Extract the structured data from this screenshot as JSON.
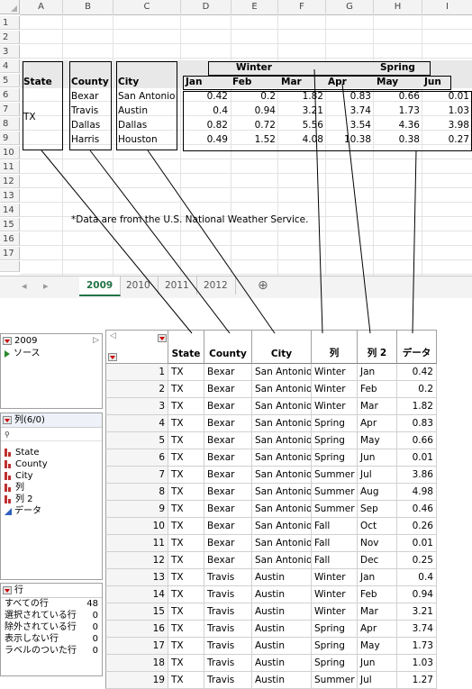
{
  "excel": {
    "columns": [
      "A",
      "B",
      "C",
      "D",
      "E",
      "F",
      "G",
      "H",
      "I"
    ],
    "rows": [
      "1",
      "2",
      "3",
      "4",
      "5",
      "6",
      "7",
      "8",
      "9",
      "10",
      "11",
      "12",
      "13",
      "14",
      "15",
      "16",
      "17"
    ],
    "header_row4": {
      "winter": "Winter",
      "spring": "Spring"
    },
    "header_row5": {
      "state": "State",
      "county": "County",
      "city": "City",
      "jan": "Jan",
      "feb": "Feb",
      "mar": "Mar",
      "apr": "Apr",
      "may": "May",
      "jun": "Jun"
    },
    "state_merged": "TX",
    "data_rows": [
      {
        "county": "Bexar",
        "city": "San Antonio",
        "vals": [
          "0.42",
          "0.2",
          "1.82",
          "0.83",
          "0.66",
          "0.01"
        ]
      },
      {
        "county": "Travis",
        "city": "Austin",
        "vals": [
          "0.4",
          "0.94",
          "3.21",
          "3.74",
          "1.73",
          "1.03"
        ]
      },
      {
        "county": "Dallas",
        "city": "Dallas",
        "vals": [
          "0.82",
          "0.72",
          "5.56",
          "3.54",
          "4.36",
          "3.98"
        ]
      },
      {
        "county": "Harris",
        "city": "Houston",
        "vals": [
          "0.49",
          "1.52",
          "4.08",
          "10.38",
          "0.38",
          "0.27"
        ]
      }
    ],
    "note": "*Data are from the U.S. National Weather Service.",
    "sheet_tabs": [
      "2009",
      "2010",
      "2011",
      "2012"
    ],
    "active_tab": "2009",
    "add_sheet_symbol": "⊕",
    "nav_left": "◂",
    "nav_right": "▸"
  },
  "jmp": {
    "table_panel": {
      "title": "2009",
      "source": "ソース"
    },
    "columns_panel": {
      "title": "列(6/0)",
      "search_symbol": "🔍",
      "items": [
        {
          "label": "State",
          "icon": "nominal-icon"
        },
        {
          "label": "County",
          "icon": "nominal-icon"
        },
        {
          "label": "City",
          "icon": "nominal-icon"
        },
        {
          "label": "列",
          "icon": "nominal-icon"
        },
        {
          "label": "列 2",
          "icon": "nominal-icon"
        },
        {
          "label": "データ",
          "icon": "continuous-icon"
        }
      ]
    },
    "rows_panel": {
      "title": "行",
      "items": [
        {
          "label": "すべての行",
          "value": "48"
        },
        {
          "label": "選択されている行",
          "value": "0"
        },
        {
          "label": "除外されている行",
          "value": "0"
        },
        {
          "label": "表示しない行",
          "value": "0"
        },
        {
          "label": "ラベルのついた行",
          "value": "0"
        }
      ]
    },
    "table_headers": [
      "State",
      "County",
      "City",
      "列",
      "列 2",
      "データ"
    ],
    "table_rows": [
      [
        "1",
        "TX",
        "Bexar",
        "San Antonio",
        "Winter",
        "Jan",
        "0.42"
      ],
      [
        "2",
        "TX",
        "Bexar",
        "San Antonio",
        "Winter",
        "Feb",
        "0.2"
      ],
      [
        "3",
        "TX",
        "Bexar",
        "San Antonio",
        "Winter",
        "Mar",
        "1.82"
      ],
      [
        "4",
        "TX",
        "Bexar",
        "San Antonio",
        "Spring",
        "Apr",
        "0.83"
      ],
      [
        "5",
        "TX",
        "Bexar",
        "San Antonio",
        "Spring",
        "May",
        "0.66"
      ],
      [
        "6",
        "TX",
        "Bexar",
        "San Antonio",
        "Spring",
        "Jun",
        "0.01"
      ],
      [
        "7",
        "TX",
        "Bexar",
        "San Antonio",
        "Summer",
        "Jul",
        "3.86"
      ],
      [
        "8",
        "TX",
        "Bexar",
        "San Antonio",
        "Summer",
        "Aug",
        "4.98"
      ],
      [
        "9",
        "TX",
        "Bexar",
        "San Antonio",
        "Summer",
        "Sep",
        "0.46"
      ],
      [
        "10",
        "TX",
        "Bexar",
        "San Antonio",
        "Fall",
        "Oct",
        "0.26"
      ],
      [
        "11",
        "TX",
        "Bexar",
        "San Antonio",
        "Fall",
        "Nov",
        "0.01"
      ],
      [
        "12",
        "TX",
        "Bexar",
        "San Antonio",
        "Fall",
        "Dec",
        "0.25"
      ],
      [
        "13",
        "TX",
        "Travis",
        "Austin",
        "Winter",
        "Jan",
        "0.4"
      ],
      [
        "14",
        "TX",
        "Travis",
        "Austin",
        "Winter",
        "Feb",
        "0.94"
      ],
      [
        "15",
        "TX",
        "Travis",
        "Austin",
        "Winter",
        "Mar",
        "3.21"
      ],
      [
        "16",
        "TX",
        "Travis",
        "Austin",
        "Spring",
        "Apr",
        "3.74"
      ],
      [
        "17",
        "TX",
        "Travis",
        "Austin",
        "Spring",
        "May",
        "1.73"
      ],
      [
        "18",
        "TX",
        "Travis",
        "Austin",
        "Spring",
        "Jun",
        "1.03"
      ],
      [
        "19",
        "TX",
        "Travis",
        "Austin",
        "Summer",
        "Jul",
        "1.27"
      ]
    ]
  },
  "colors": {
    "excel_tab_green": "#217346",
    "jmp_red": "#c00000",
    "jmp_blue": "#2f5fbf"
  }
}
